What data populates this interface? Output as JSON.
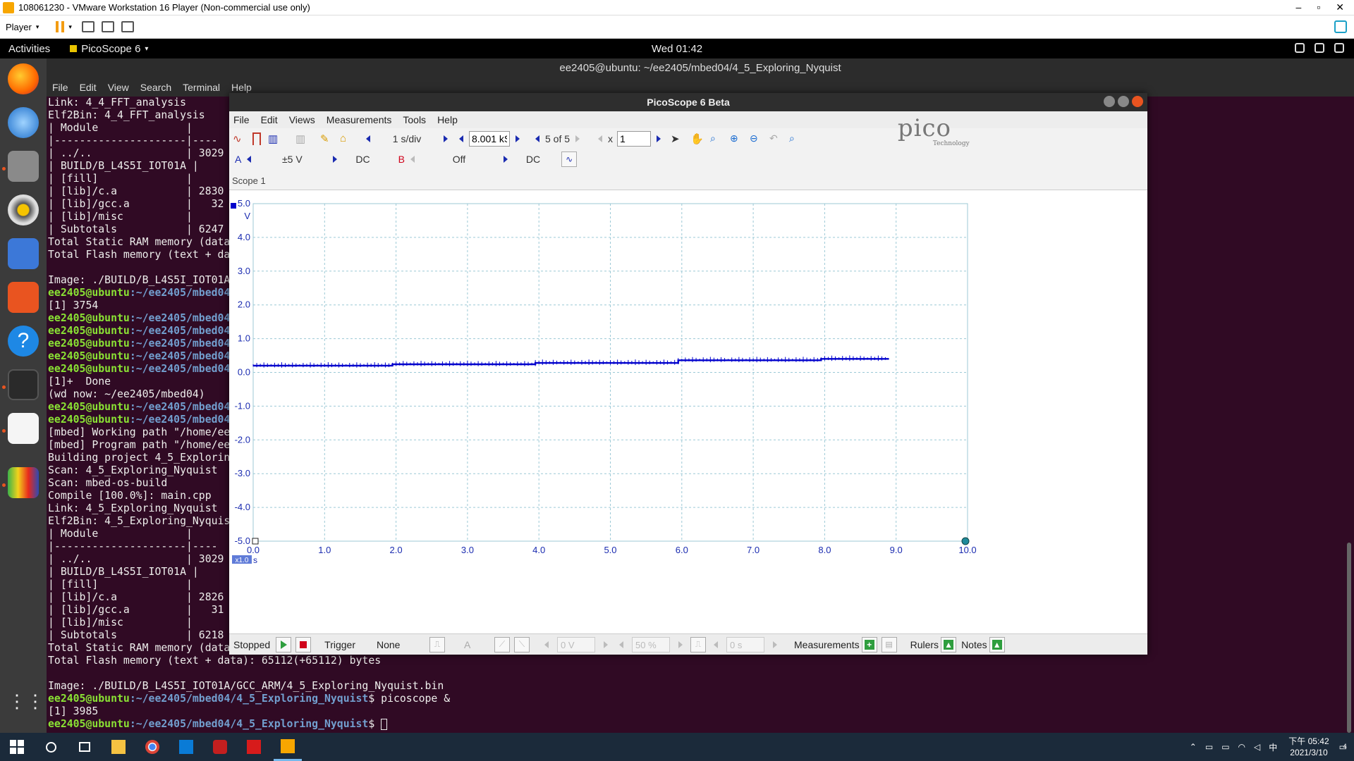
{
  "vmware": {
    "title": "108061230 - VMware Workstation 16 Player (Non-commercial use only)",
    "player_label": "Player",
    "window_controls": [
      "–",
      "▫",
      "✕"
    ]
  },
  "ubuntu": {
    "activities": "Activities",
    "app_menu": "PicoScope 6",
    "clock": "Wed 01:42"
  },
  "terminal": {
    "title": "ee2405@ubuntu: ~/ee2405/mbed04/4_5_Exploring_Nyquist",
    "menu": [
      "File",
      "Edit",
      "View",
      "Search",
      "Terminal",
      "Help"
    ],
    "lines": [
      {
        "t": "Link: 4_4_FFT_analysis"
      },
      {
        "t": "Elf2Bin: 4_4_FFT_analysis"
      },
      {
        "t": "| Module              |"
      },
      {
        "t": "|---------------------|----"
      },
      {
        "t": "| ../..               | 3029"
      },
      {
        "t": "| BUILD/B_L4S5I_IOT01A |"
      },
      {
        "t": "| [fill]              |"
      },
      {
        "t": "| [lib]/c.a           | 2830"
      },
      {
        "t": "| [lib]/gcc.a         |   32"
      },
      {
        "t": "| [lib]/misc          |"
      },
      {
        "t": "| Subtotals           | 6247"
      },
      {
        "t": "Total Static RAM memory (data"
      },
      {
        "t": "Total Flash memory (text + da"
      },
      {
        "t": ""
      },
      {
        "t": "Image: ./BUILD/B_L4S5I_IOT01A"
      },
      {
        "p": "ee2405@ubuntu",
        "d": ":~/ee2405/mbed04",
        "t": ""
      },
      {
        "t": "[1] 3754"
      },
      {
        "p": "ee2405@ubuntu",
        "d": ":~/ee2405/mbed04",
        "t": ""
      },
      {
        "p": "ee2405@ubuntu",
        "d": ":~/ee2405/mbed04",
        "t": ""
      },
      {
        "p": "ee2405@ubuntu",
        "d": ":~/ee2405/mbed04",
        "t": ""
      },
      {
        "p": "ee2405@ubuntu",
        "d": ":~/ee2405/mbed04",
        "t": ""
      },
      {
        "p": "ee2405@ubuntu",
        "d": ":~/ee2405/mbed04",
        "t": ""
      },
      {
        "t": "[1]+  Done"
      },
      {
        "t": "(wd now: ~/ee2405/mbed04)"
      },
      {
        "p": "ee2405@ubuntu",
        "d": ":~/ee2405/mbed04",
        "t": ""
      },
      {
        "p": "ee2405@ubuntu",
        "d": ":~/ee2405/mbed04",
        "t": ""
      },
      {
        "t": "[mbed] Working path \"/home/ee"
      },
      {
        "t": "[mbed] Program path \"/home/ee"
      },
      {
        "t": "Building project 4_5_Explorin"
      },
      {
        "t": "Scan: 4_5_Exploring_Nyquist"
      },
      {
        "t": "Scan: mbed-os-build"
      },
      {
        "t": "Compile [100.0%]: main.cpp"
      },
      {
        "t": "Link: 4_5_Exploring_Nyquist"
      },
      {
        "t": "Elf2Bin: 4_5_Exploring_Nyquis"
      },
      {
        "t": "| Module              |"
      },
      {
        "t": "|---------------------|----"
      },
      {
        "t": "| ../..               | 3029"
      },
      {
        "t": "| BUILD/B_L4S5I_IOT01A |"
      },
      {
        "t": "| [fill]              |"
      },
      {
        "t": "| [lib]/c.a           | 2826"
      },
      {
        "t": "| [lib]/gcc.a         |   31"
      },
      {
        "t": "| [lib]/misc          |"
      },
      {
        "t": "| Subtotals           | 6218"
      },
      {
        "t": "Total Static RAM memory (data"
      },
      {
        "t": "Total Flash memory (text + data): 65112(+65112) bytes"
      },
      {
        "t": ""
      },
      {
        "t": "Image: ./BUILD/B_L4S5I_IOT01A/GCC_ARM/4_5_Exploring_Nyquist.bin"
      },
      {
        "p": "ee2405@ubuntu",
        "d": ":~/ee2405/mbed04/4_5_Exploring_Nyquist",
        "t": "$ picoscope &"
      },
      {
        "t": "[1] 3985"
      },
      {
        "p": "ee2405@ubuntu",
        "d": ":~/ee2405/mbed04/4_5_Exploring_Nyquist",
        "t": "$ ",
        "cursor": true
      }
    ]
  },
  "picoscope": {
    "title": "PicoScope 6 Beta",
    "menu": [
      "File",
      "Edit",
      "Views",
      "Measurements",
      "Tools",
      "Help"
    ],
    "timebase": "1 s/div",
    "samples": "8.001 kS",
    "capture_index": "5 of 5",
    "zoom_prefix": "x",
    "zoom_value": "1",
    "channel_a_label": "A",
    "channel_a_range": "±5 V",
    "channel_a_coupling": "DC",
    "channel_b_label": "B",
    "channel_b_range": "Off",
    "channel_b_coupling": "DC",
    "logo_text": "pico",
    "logo_sub": "Technology",
    "scope_tab": "Scope 1",
    "x_scale_badge": "x1.0",
    "status": {
      "run_state": "Stopped",
      "trigger_label": "Trigger",
      "trigger_mode": "None",
      "channel": "A",
      "threshold": "0 V",
      "pre_trigger": "50 %",
      "delay": "0 s",
      "measurements": "Measurements",
      "rulers": "Rulers",
      "notes": "Notes"
    }
  },
  "chart_data": {
    "type": "line",
    "xlabel": "s",
    "ylabel": "V",
    "xlim": [
      0,
      10
    ],
    "ylim": [
      -5,
      5
    ],
    "x_ticks": [
      "0.0",
      "1.0",
      "2.0",
      "3.0",
      "4.0",
      "5.0",
      "6.0",
      "7.0",
      "8.0",
      "9.0",
      "10.0"
    ],
    "y_ticks": [
      "5.0",
      "4.0",
      "3.0",
      "2.0",
      "1.0",
      "0.0",
      "-1.0",
      "-2.0",
      "-3.0",
      "-4.0",
      "-5.0"
    ],
    "grid": true,
    "line_color": "#0000cc",
    "series": [
      {
        "x": [
          0.0,
          1.95,
          1.95,
          3.95,
          3.95,
          5.95,
          5.95,
          7.95,
          7.95,
          8.9
        ],
        "y": [
          0.2,
          0.2,
          0.24,
          0.24,
          0.28,
          0.28,
          0.36,
          0.36,
          0.4,
          0.4
        ]
      }
    ]
  },
  "windows": {
    "clock_time": "下午 05:42",
    "clock_date": "2021/3/10",
    "ime": "中",
    "notification_count": "4"
  }
}
